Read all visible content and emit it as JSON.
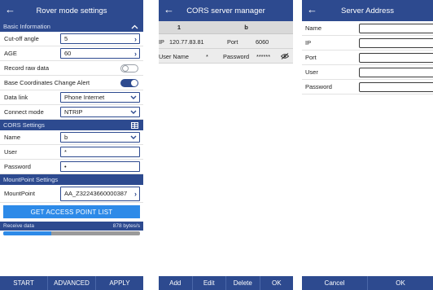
{
  "rover": {
    "title": "Rover mode settings",
    "basic_section": "Basic Information",
    "collapse_icon": "chevron-up-icon",
    "cutoff": {
      "label": "Cut-off angle",
      "value": "5"
    },
    "age": {
      "label": "AGE",
      "value": "60"
    },
    "record_raw": {
      "label": "Record raw data",
      "on": false
    },
    "base_alert": {
      "label": "Base Coordinates Change Alert",
      "on": true
    },
    "data_link": {
      "label": "Data link",
      "value": "Phone Internet"
    },
    "connect_mode": {
      "label": "Connect mode",
      "value": "NTRIP"
    },
    "cors_section": "CORS Settings",
    "cors_name": {
      "label": "Name",
      "value": "b"
    },
    "cors_user": {
      "label": "User",
      "value": "*"
    },
    "cors_password": {
      "label": "Password",
      "value": "•"
    },
    "mount_section": "MountPoint Settings",
    "mountpoint": {
      "label": "MountPoint",
      "value": "AA_Z32243660000387"
    },
    "get_ap_button": "GET ACCESS POINT LIST",
    "receive": {
      "label": "Receive data",
      "rate": "878 bytes/s",
      "progress": 0.35
    },
    "buttons": {
      "start": "START",
      "advanced": "ADVANCED",
      "apply": "APPLY"
    }
  },
  "cors_manager": {
    "title": "CORS server manager",
    "header": {
      "col1": "1",
      "col2": "b"
    },
    "ip_label": "IP",
    "ip_value": "120.77.83.81",
    "port_label": "Port",
    "port_value": "6060",
    "user_label": "User Name",
    "user_value": "*",
    "password_label": "Password",
    "password_value": "******",
    "buttons": {
      "add": "Add",
      "edit": "Edit",
      "delete": "Delete",
      "ok": "OK"
    }
  },
  "server_address": {
    "title": "Server Address",
    "fields": {
      "name": "Name",
      "ip": "IP",
      "port": "Port",
      "user": "User",
      "password": "Password"
    },
    "buttons": {
      "cancel": "Cancel",
      "ok": "OK"
    }
  },
  "colors": {
    "primary": "#2d4a8f",
    "accent": "#2d8ae8"
  }
}
